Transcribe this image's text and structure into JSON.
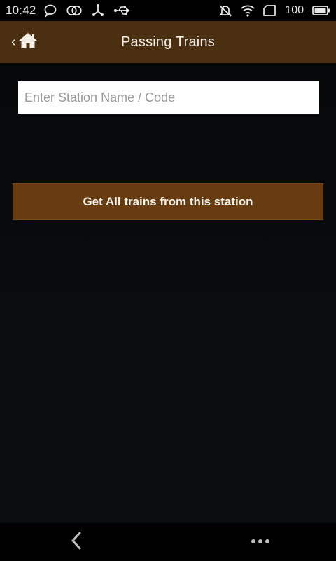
{
  "status_bar": {
    "time": "10:42",
    "battery_level": "100",
    "icons_left": [
      "chat-bubble-icon",
      "linked-rings-icon",
      "usb-tether-icon",
      "usb-icon"
    ],
    "icons_right": [
      "vibrate-off-icon",
      "wifi-icon",
      "sim-icon",
      "battery-icon"
    ]
  },
  "app_bar": {
    "title": "Passing Trains",
    "back_chevron": "‹",
    "home_icon": "home-icon"
  },
  "search": {
    "placeholder": "Enter Station Name / Code",
    "value": ""
  },
  "actions": {
    "get_trains_label": "Get All trains from this station"
  },
  "nav_bar": {
    "back_icon": "chevron-left-icon",
    "more_icon": "more-dots-icon"
  },
  "colors": {
    "app_bar": "#4a2f10",
    "button": "#663c10",
    "background": "#0a0d10",
    "text_light": "#f3efe7"
  }
}
